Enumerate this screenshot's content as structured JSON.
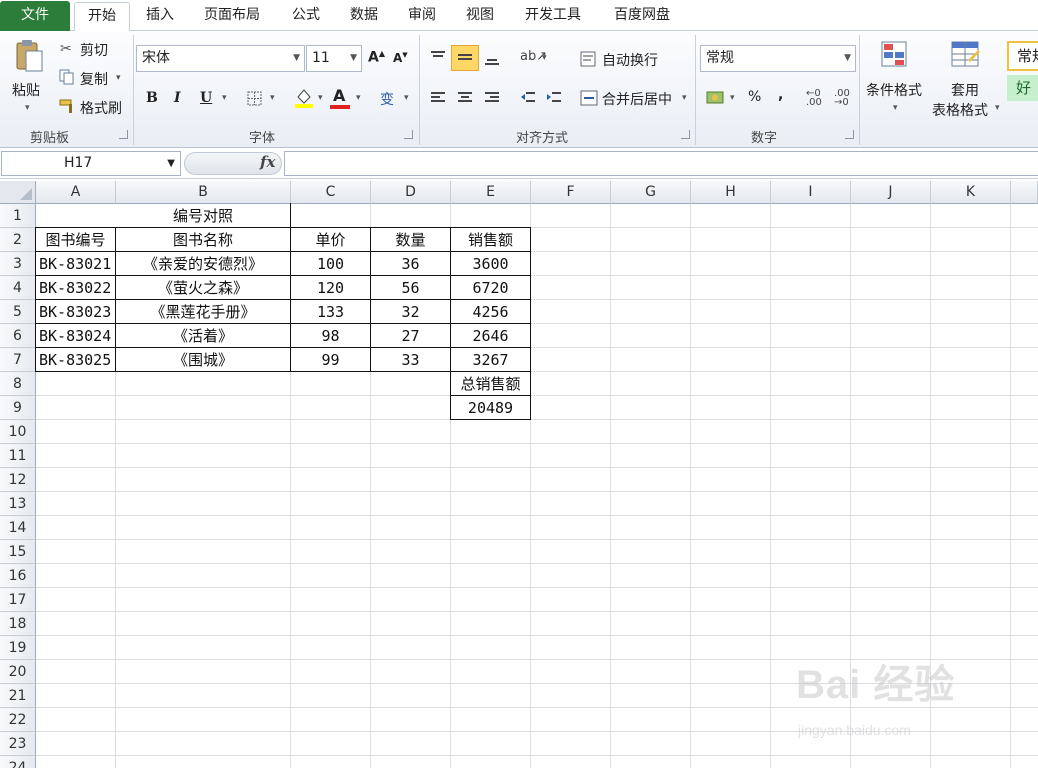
{
  "tabs": [
    "文件",
    "开始",
    "插入",
    "页面布局",
    "公式",
    "数据",
    "审阅",
    "视图",
    "开发工具",
    "百度网盘"
  ],
  "clipboard": {
    "paste": "粘贴",
    "cut": "剪切",
    "copy": "复制",
    "format_painter": "格式刷",
    "label": "剪贴板"
  },
  "font": {
    "name": "宋体",
    "size": "11",
    "bold": "B",
    "italic": "I",
    "underline": "U",
    "wen": "变",
    "label": "字体"
  },
  "align": {
    "wrap": "自动换行",
    "merge": "合并后居中",
    "label": "对齐方式"
  },
  "number": {
    "format": "常规",
    "percent": "%",
    "comma": ",",
    "label": "数字"
  },
  "styles": {
    "conditional_1": "条件格式",
    "apply_1": "套用",
    "apply_2": "表格格式",
    "style_normal": "常规",
    "style_good": "好"
  },
  "formula_bar": {
    "name_box": "H17",
    "fx": "fx"
  },
  "columns": [
    "A",
    "B",
    "C",
    "D",
    "E",
    "F",
    "G",
    "H",
    "I",
    "J",
    "K"
  ],
  "rows": [
    "1",
    "2",
    "3",
    "4",
    "5",
    "6",
    "7",
    "8",
    "9",
    "10",
    "11",
    "12",
    "13",
    "14",
    "15",
    "16",
    "17",
    "18",
    "19",
    "20",
    "21",
    "22",
    "23",
    "24"
  ],
  "sheet": {
    "title": "编号对照",
    "headers": [
      "图书编号",
      "图书名称",
      "单价",
      "数量",
      "销售额"
    ],
    "records": [
      [
        "BK-83021",
        "《亲爱的安德烈》",
        "100",
        "36",
        "3600"
      ],
      [
        "BK-83022",
        "《萤火之森》",
        "120",
        "56",
        "6720"
      ],
      [
        "BK-83023",
        "《黑莲花手册》",
        "133",
        "32",
        "4256"
      ],
      [
        "BK-83024",
        "《活着》",
        "98",
        "27",
        "2646"
      ],
      [
        "BK-83025",
        "《围城》",
        "99",
        "33",
        "3267"
      ]
    ],
    "total_label": "总销售额",
    "total_value": "20489"
  },
  "watermark": {
    "logo": "Bai 经验",
    "url": "jingyan.baidu.com"
  },
  "colors": {
    "file_tab": "#2d7d3a",
    "grid_line": "#dadee4",
    "style_good_bg": "#c6efce"
  }
}
